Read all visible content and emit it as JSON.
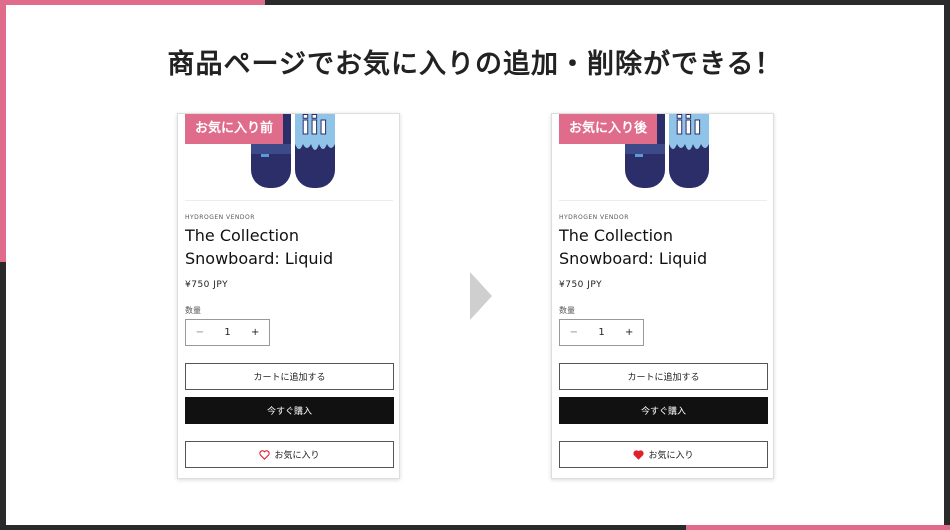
{
  "headline": "商品ページでお気に入りの追加・削除ができる！",
  "colors": {
    "accent": "#e06c8c",
    "heart_filled": "#e0202c",
    "buy_button": "#111111"
  },
  "cards": [
    {
      "badge": "お気に入り前",
      "vendor": "HYDROGEN VENDOR",
      "title_line1": "The Collection",
      "title_line2": "Snowboard: Liquid",
      "price": "¥750 JPY",
      "quantity_label": "数量",
      "quantity_value": "1",
      "minus": "−",
      "plus": "+",
      "add_to_cart": "カートに追加する",
      "buy_now": "今すぐ購入",
      "favorite": "お気に入り",
      "favorite_icon": "heart-outline-icon"
    },
    {
      "badge": "お気に入り後",
      "vendor": "HYDROGEN VENDOR",
      "title_line1": "The Collection",
      "title_line2": "Snowboard: Liquid",
      "price": "¥750 JPY",
      "quantity_label": "数量",
      "quantity_value": "1",
      "minus": "−",
      "plus": "+",
      "add_to_cart": "カートに追加する",
      "buy_now": "今すぐ購入",
      "favorite": "お気に入り",
      "favorite_icon": "heart-filled-icon"
    }
  ]
}
